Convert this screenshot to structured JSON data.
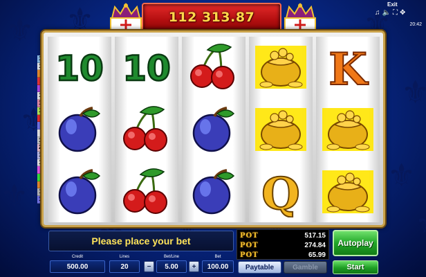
{
  "jackpot": {
    "value": "112 313.87"
  },
  "status": {
    "exit_label": "Exit",
    "clock": "20:42"
  },
  "line_markers": [
    {
      "n": "16",
      "color": "#9ad0ff"
    },
    {
      "n": "10",
      "color": "#ffffff"
    },
    {
      "n": "6",
      "color": "#ff9a30"
    },
    {
      "n": "2",
      "color": "#ff3a3a"
    },
    {
      "n": "4",
      "color": "#c050ff"
    },
    {
      "n": "14",
      "color": "#ffffff"
    },
    {
      "n": "18",
      "color": "#ff9ab8"
    },
    {
      "n": "12",
      "color": "#c8ff60"
    },
    {
      "n": "8",
      "color": "#ff3030"
    },
    {
      "n": "1",
      "color": "#8080ff"
    },
    {
      "n": "9",
      "color": "#ffffff"
    },
    {
      "n": "13",
      "color": "#dddddd"
    },
    {
      "n": "20",
      "color": "#ffd0e0"
    },
    {
      "n": "19",
      "color": "#d0d0ff"
    },
    {
      "n": "15",
      "color": "#ffffff"
    },
    {
      "n": "5",
      "color": "#ff60ff"
    },
    {
      "n": "3",
      "color": "#40ff40"
    },
    {
      "n": "7",
      "color": "#ff9a30"
    },
    {
      "n": "11",
      "color": "#c8c8c8"
    },
    {
      "n": "17",
      "color": "#8080ff"
    }
  ],
  "reels": [
    [
      "ten",
      "plum",
      "plum"
    ],
    [
      "ten",
      "cherry",
      "cherry"
    ],
    [
      "cherry",
      "plum",
      "plum"
    ],
    [
      "gold-bag",
      "gold-bag",
      "queen"
    ],
    [
      "king",
      "gold-bag",
      "gold-bag"
    ]
  ],
  "symbol_text": {
    "ten": "10",
    "king": "K",
    "queen": "Q"
  },
  "message": "Please place your bet",
  "pots": [
    {
      "label": "POT",
      "value": "517.15"
    },
    {
      "label": "POT",
      "value": "274.84"
    },
    {
      "label": "POT",
      "value": "65.99"
    }
  ],
  "credit": {
    "label": "Credit",
    "value": "500.00"
  },
  "lines": {
    "label": "Lines",
    "value": "20"
  },
  "bet_line": {
    "label": "Bet/Line",
    "value": "5.00",
    "minus": "−",
    "plus": "+"
  },
  "bet": {
    "label": "Bet",
    "value": "100.00"
  },
  "buttons": {
    "autoplay": "Autoplay",
    "paytable": "Paytable",
    "gamble": "Gamble",
    "start": "Start"
  }
}
